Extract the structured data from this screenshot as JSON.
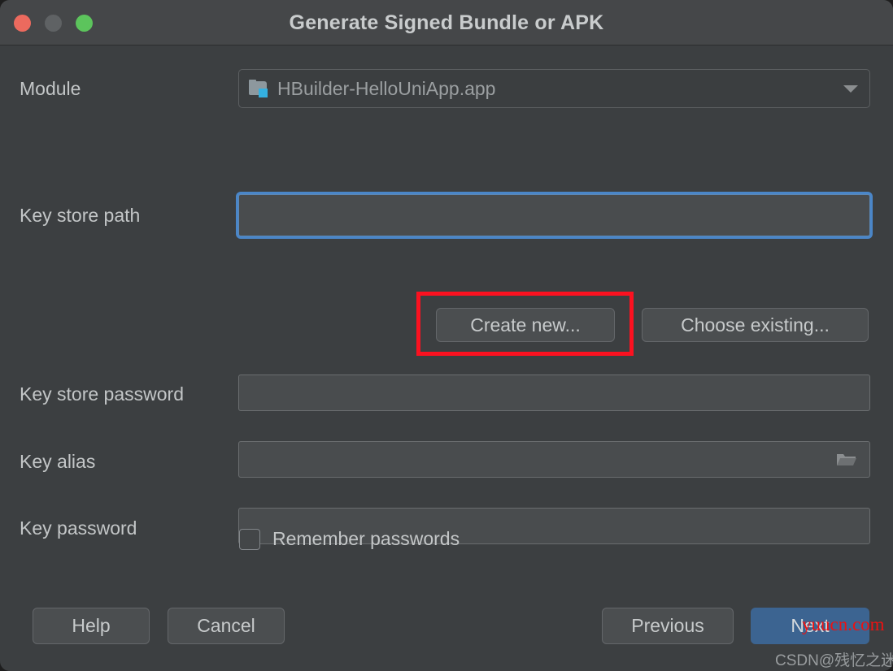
{
  "window": {
    "title": "Generate Signed Bundle or APK",
    "controls": [
      {
        "name": "close",
        "color": "#ec6a5e"
      },
      {
        "name": "minimize",
        "color": "#5f6264"
      },
      {
        "name": "maximize",
        "color": "#5cc45c"
      }
    ]
  },
  "form": {
    "module": {
      "label": "Module",
      "value": "HBuilder-HelloUniApp.app",
      "icon": "module-folder-icon",
      "dropdown_icon": "chevron-down-icon"
    },
    "key_store_path": {
      "label": "Key store path",
      "value": "",
      "focused": true
    },
    "key_store_actions": {
      "create_new": "Create new...",
      "choose_existing": "Choose existing..."
    },
    "key_store_password": {
      "label": "Key store password",
      "value": ""
    },
    "key_alias": {
      "label": "Key alias",
      "value": "",
      "browse_icon": "folder-open-icon"
    },
    "key_password": {
      "label": "Key password",
      "value": ""
    },
    "remember_passwords": {
      "label": "Remember passwords",
      "checked": false
    }
  },
  "footer": {
    "help": "Help",
    "cancel": "Cancel",
    "previous": "Previous",
    "next": "Next"
  },
  "annotation": {
    "highlight_target": "Create new...",
    "color": "#fb1120"
  },
  "watermarks": {
    "red": "yuucn.com",
    "gray": "CSDN@残忆之迷惘"
  },
  "colors": {
    "dialog_background": "#3c3f41",
    "titlebar_background": "#454749",
    "field_background": "#494c4e",
    "focus_ring": "#4a86c8",
    "primary_button": "#3c6491",
    "text": "#c3c6c7",
    "muted_text": "#9b9fa1"
  }
}
